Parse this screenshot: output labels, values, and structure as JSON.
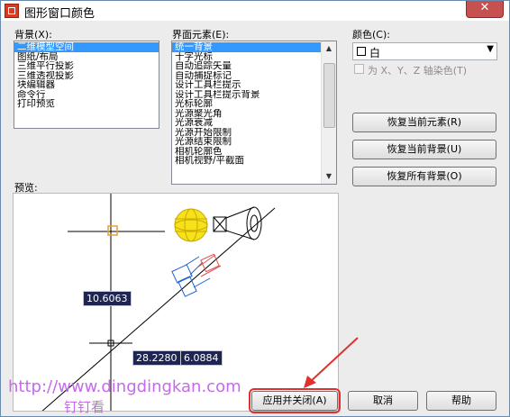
{
  "window": {
    "title": "图形窗口颜色",
    "close_label": "✕"
  },
  "context": {
    "label": "背景(X):",
    "items": [
      "二维模型空间",
      "图纸/布局",
      "三维平行投影",
      "三维透视投影",
      "块编辑器",
      "命令行",
      "打印预览"
    ],
    "selected_index": 0
  },
  "elements": {
    "label": "界面元素(E):",
    "items": [
      "统一背景",
      "十字光标",
      "自动追踪矢量",
      "自动捕捉标记",
      "设计工具栏提示",
      "设计工具栏提示背景",
      "光标轮廓",
      "光源聚光角",
      "光源衰减",
      "光源开始限制",
      "光源结束限制",
      "相机轮廓色",
      "相机视野/平截面"
    ],
    "selected_index": 0
  },
  "color": {
    "label": "颜色(C):",
    "value": "白",
    "swatch_color": "#ffffff",
    "tint_checkbox_label": "为 X、Y、Z 轴染色(T)",
    "tint_checked": false
  },
  "restore_buttons": {
    "element": "恢复当前元素(R)",
    "context": "恢复当前背景(U)",
    "all": "恢复所有背景(O)"
  },
  "preview": {
    "label": "预览:",
    "coord_1": "10.6063",
    "coord_2": "28.2280",
    "coord_3": "6.0884"
  },
  "footer": {
    "apply_close": "应用并关闭(A)",
    "cancel": "取消",
    "help": "帮助"
  },
  "watermark": {
    "url": "http://www.dingdingkan.com",
    "text": "钉钉看"
  },
  "colors": {
    "selection": "#3399ff",
    "annotation": "#e0312f",
    "watermark": "#c56ae8",
    "tooltip_bg": "#1f2552"
  }
}
